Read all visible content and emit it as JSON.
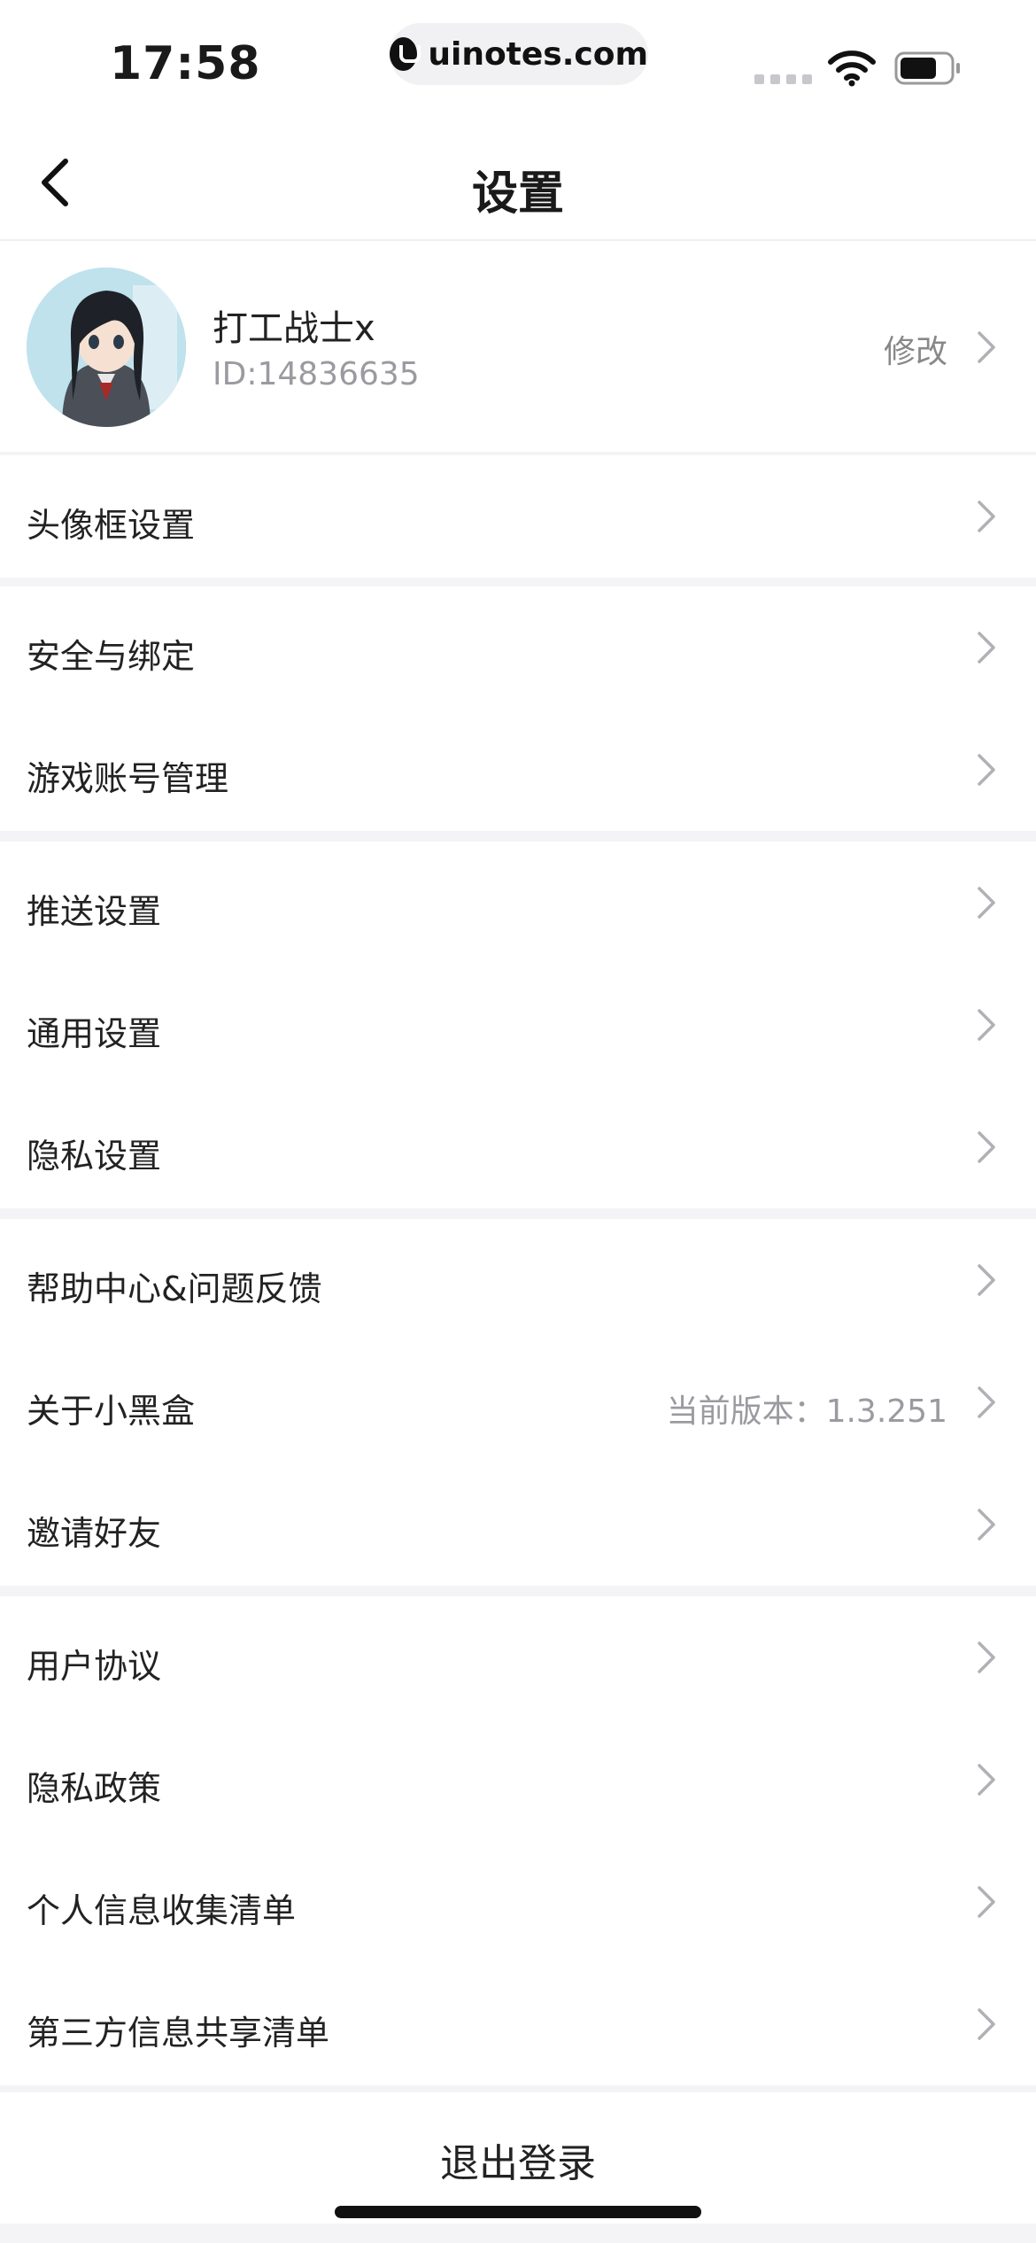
{
  "status_bar": {
    "time": "17:58",
    "url": "uinotes.com"
  },
  "nav": {
    "title": "设置",
    "back_icon": "chevron-left-icon"
  },
  "profile": {
    "name": "打工战士x",
    "id_text": "ID:14836635",
    "edit_label": "修改"
  },
  "items": [
    {
      "label": "头像框设置"
    },
    {
      "label": "安全与绑定"
    },
    {
      "label": "游戏账号管理"
    },
    {
      "label": "推送设置"
    },
    {
      "label": "通用设置"
    },
    {
      "label": "隐私设置"
    },
    {
      "label": "帮助中心&问题反馈"
    },
    {
      "label": "关于小黑盒",
      "value": "当前版本：1.3.251"
    },
    {
      "label": "邀请好友"
    },
    {
      "label": "用户协议"
    },
    {
      "label": "隐私政策"
    },
    {
      "label": "个人信息收集清单"
    },
    {
      "label": "第三方信息共享清单"
    }
  ],
  "logout": {
    "label": "退出登录"
  },
  "colors": {
    "background": "#f4f4f6",
    "card": "#ffffff",
    "text": "#222222",
    "secondary": "#9a9aa0"
  }
}
